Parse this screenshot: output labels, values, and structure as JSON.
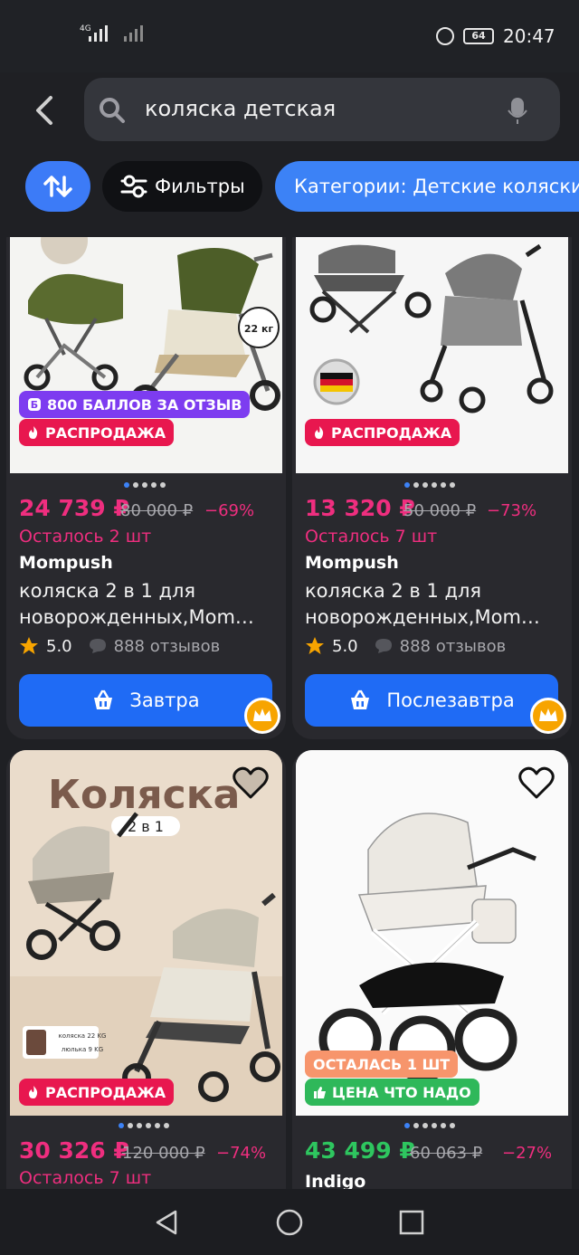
{
  "status_bar": {
    "network_label": "4G",
    "battery": "64",
    "time": "20:47"
  },
  "search": {
    "query": "коляска детская"
  },
  "chips": {
    "filters_label": "Фильтры",
    "category_label": "Категории: Детские коляски-"
  },
  "products": [
    {
      "bonus_badge": "800 БАЛЛОВ ЗА ОТЗЫВ",
      "image_weight_label": "22 кг",
      "sale_badge": "РАСПРОДАЖА",
      "price": "24 739 ₽",
      "old_price": "80 000 ₽",
      "discount": "−69%",
      "stock": "Осталось 2 шт",
      "brand": "Mompush",
      "title": "коляска 2 в 1 для новорожденных,Mom…",
      "rating": "5.0",
      "reviews": "888 отзывов",
      "delivery": "Завтра"
    },
    {
      "sale_badge": "РАСПРОДАЖА",
      "price": "13 320 ₽",
      "old_price": "50 000 ₽",
      "discount": "−73%",
      "stock": "Осталось 7 шт",
      "brand": "Mompush",
      "title": "коляска 2 в 1 для новорожденных,Mom…",
      "rating": "5.0",
      "reviews": "888 отзывов",
      "delivery": "Послезавтра"
    },
    {
      "image_title": "Коляска",
      "image_subtitle": "2 в 1",
      "image_spec_1": "коляска 22 KG",
      "image_spec_2": "люлька 9 KG",
      "sale_badge": "РАСПРОДАЖА",
      "price": "30 326 ₽",
      "old_price": "120 000 ₽",
      "discount": "−74%",
      "stock": "Осталось 7 шт"
    },
    {
      "left_badge": "ОСТАЛАСЬ 1 ШТ",
      "price_badge": "ЦЕНА ЧТО НАДО",
      "price": "43 499 ₽",
      "old_price": "60 063 ₽",
      "discount": "−27%",
      "brand": "Indigo"
    }
  ],
  "colors": {
    "accent_blue": "#3c82f6",
    "sale_pink": "#ef2e7f",
    "price_green": "#2ec65f",
    "background": "#1f2024"
  }
}
